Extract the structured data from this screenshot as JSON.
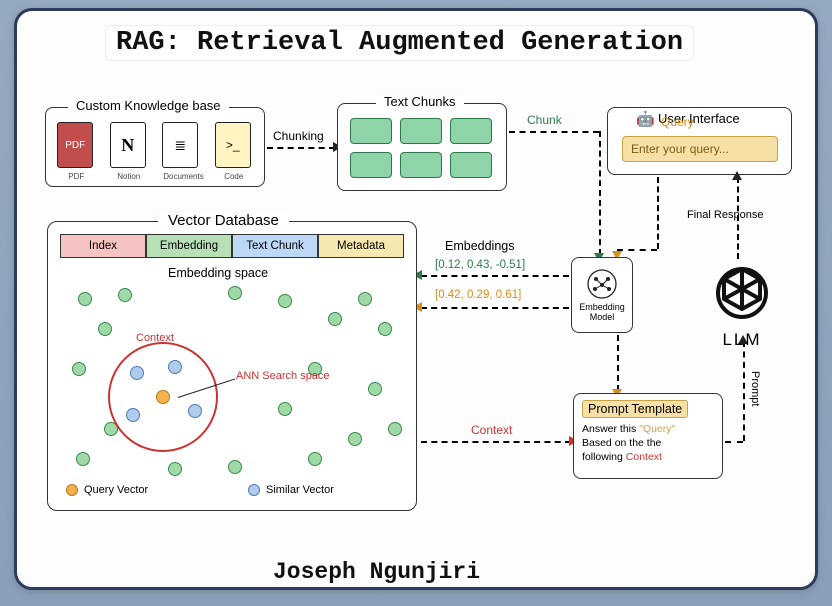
{
  "title": "RAG: Retrieval Augmented Generation",
  "author": "Joseph Ngunjiri",
  "knowledge_base": {
    "label": "Custom Knowledge base",
    "items": [
      "PDF",
      "Notion",
      "Documents",
      "Code"
    ]
  },
  "chunks": {
    "label": "Text Chunks"
  },
  "arrows": {
    "chunking": "Chunking",
    "chunk": "Chunk",
    "query": "Query",
    "embeddings": "Embeddings",
    "vec_green": "[0.12, 0.43, -0.51]",
    "vec_orange": "[0.42, 0.29, 0.61]",
    "context": "Context",
    "prompt": "Prompt",
    "final_response": "Final Response"
  },
  "ui": {
    "label": "User Interface",
    "placeholder": "Enter your query..."
  },
  "vdb": {
    "label": "Vector Database",
    "cols": {
      "index": "Index",
      "embedding": "Embedding",
      "chunk": "Text Chunk",
      "meta": "Metadata"
    },
    "space": "Embedding space",
    "context": "Context",
    "ann": "ANN Search space",
    "legend": {
      "query": "Query Vector",
      "similar": "Similar Vector"
    }
  },
  "embedding_model": {
    "label": "Embedding Model"
  },
  "prompt": {
    "label": "Prompt Template",
    "line1": "Answer this",
    "query_word": "\"Query\"",
    "line2": "Based on the the",
    "line3": "following",
    "context_word": "Context"
  },
  "llm": {
    "label": "LLM"
  }
}
